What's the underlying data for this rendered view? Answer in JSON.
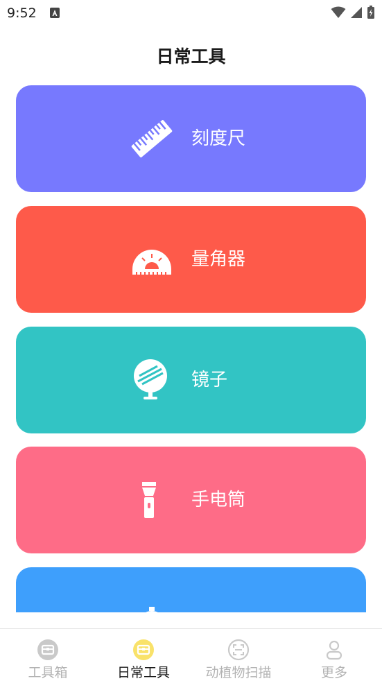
{
  "status_bar": {
    "time": "9:52"
  },
  "header": {
    "title": "日常工具"
  },
  "tools": [
    {
      "label": "刻度尺",
      "icon": "ruler-icon",
      "color": "#7779FE"
    },
    {
      "label": "量角器",
      "icon": "protractor-icon",
      "color": "#FE5A4A"
    },
    {
      "label": "镜子",
      "icon": "mirror-icon",
      "color": "#32C4C4"
    },
    {
      "label": "手电筒",
      "icon": "flashlight-icon",
      "color": "#FE6C87"
    },
    {
      "label": "",
      "icon": "stopwatch-icon",
      "color": "#3E9FFC"
    }
  ],
  "bottom_nav": {
    "items": [
      {
        "label": "工具箱",
        "icon": "toolbox-icon",
        "active": false
      },
      {
        "label": "日常工具",
        "icon": "toolbox-icon",
        "active": true
      },
      {
        "label": "动植物扫描",
        "icon": "scan-icon",
        "active": false
      },
      {
        "label": "更多",
        "icon": "person-icon",
        "active": false
      }
    ],
    "active_color": "#F9E26A",
    "inactive_color": "#C9C9C9"
  }
}
